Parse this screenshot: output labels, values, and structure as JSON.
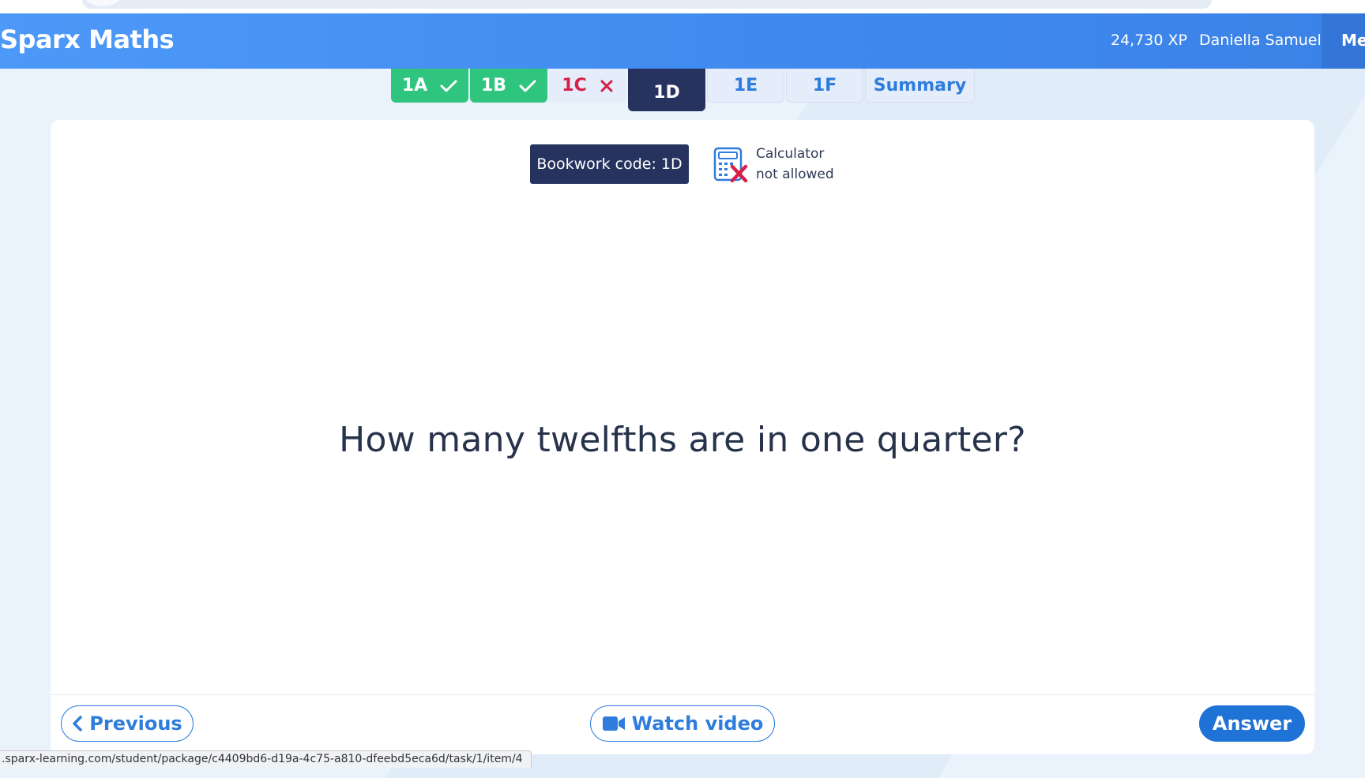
{
  "header": {
    "app_title": "Sparx Maths",
    "xp": "24,730 XP",
    "user_name": "Daniella Samuel",
    "menu_label": "Menu"
  },
  "tabs": [
    {
      "label": "1A",
      "status": "correct",
      "icon": "check-icon"
    },
    {
      "label": "1B",
      "status": "correct",
      "icon": "check-icon"
    },
    {
      "label": "1C",
      "status": "incorrect",
      "icon": "cross-icon"
    },
    {
      "label": "1D",
      "status": "current"
    },
    {
      "label": "1E",
      "status": "todo"
    },
    {
      "label": "1F",
      "status": "todo"
    },
    {
      "label": "Summary",
      "status": "todo"
    }
  ],
  "question_card": {
    "bookwork_code": "Bookwork code: 1D",
    "calculator_line1": "Calculator",
    "calculator_line2": "not allowed",
    "calculator_icon": "calculator-not-allowed-icon",
    "question_text": "How many twelfths are in one quarter?"
  },
  "footer": {
    "previous_label": "Previous",
    "watch_video_label": "Watch video",
    "answer_label": "Answer"
  },
  "status_bar": {
    "url": ".sparx-learning.com/student/package/c4409bd6-d19a-4c75-a810-dfeebd5eca6d/task/1/item/4"
  },
  "colors": {
    "header_blue": "#4d99f8",
    "correct_green": "#2fc57e",
    "incorrect_red": "#d81f47",
    "current_navy": "#26335f",
    "link_blue": "#2e7cdc"
  }
}
